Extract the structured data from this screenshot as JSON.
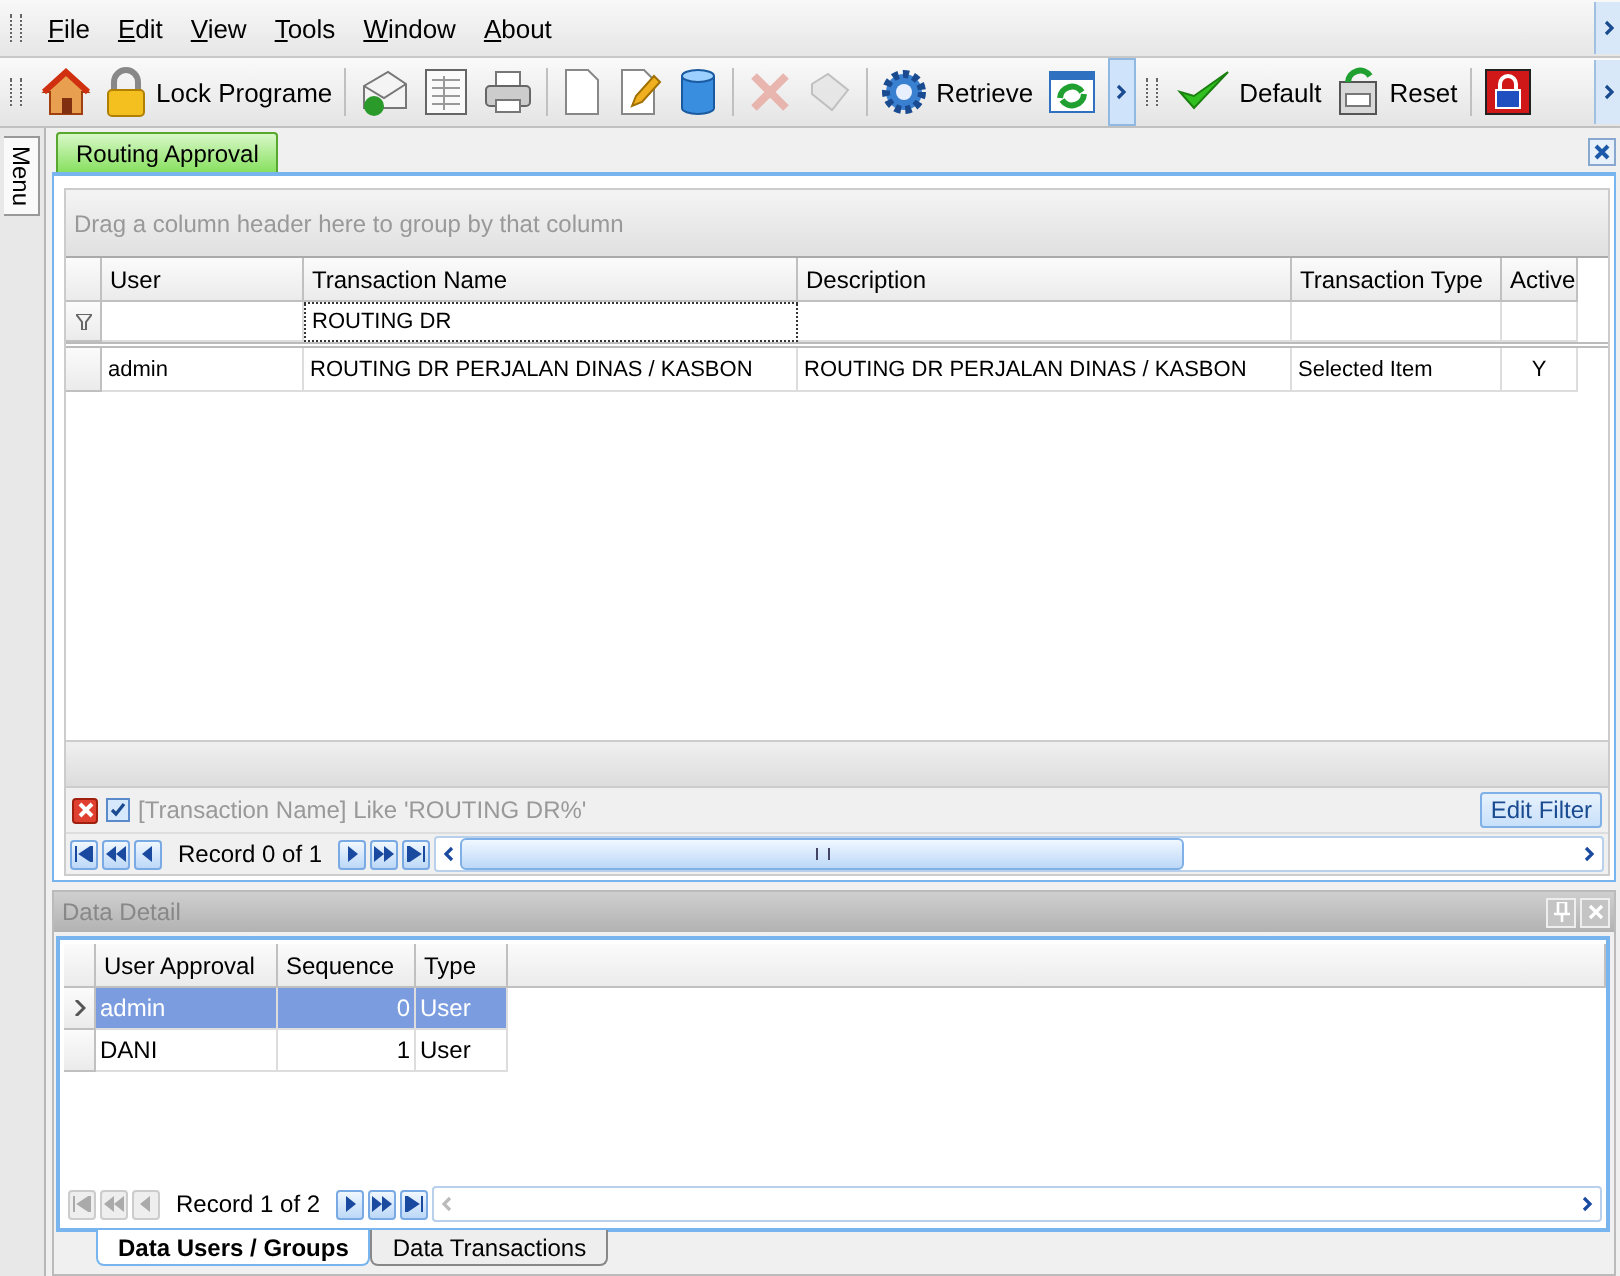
{
  "menu": [
    {
      "label": "File"
    },
    {
      "label": "Edit"
    },
    {
      "label": "View"
    },
    {
      "label": "Tools"
    },
    {
      "label": "Window"
    },
    {
      "label": "About"
    }
  ],
  "toolbar": {
    "lock_label": "Lock Programe",
    "retrieve_label": "Retrieve",
    "default_label": "Default",
    "reset_label": "Reset",
    "delete_disabled": true,
    "save_disabled": true
  },
  "side_tab": "Menu",
  "tabs": [
    {
      "label": "Routing Approval",
      "selected": true
    }
  ],
  "grid": {
    "group_hint": "Drag a column header here to group by that column",
    "columns": [
      "User",
      "Transaction Name",
      "Description",
      "Transaction Type",
      "Active"
    ],
    "filter_row": [
      {
        "focused": false
      },
      {
        "value": "ROUTING DR",
        "focused": true
      },
      {
        "focused": false
      },
      {
        "focused": false
      },
      {
        "focused": false
      }
    ],
    "rows": [
      {
        "cells": [
          "admin",
          "ROUTING DR PERJALAN DINAS / KASBON",
          "ROUTING DR PERJALAN DINAS / KASBON",
          "Selected Item",
          "Y"
        ],
        "selected": false
      }
    ],
    "filter": {
      "enabled": true,
      "text": "[Transaction Name] Like 'ROUTING DR%'",
      "edit_label": "Edit Filter"
    },
    "navigator": {
      "record": "Record 0 of 1",
      "first_disabled": false,
      "prev_disabled": false,
      "next_disabled": false
    }
  },
  "detail": {
    "title": "Data Detail",
    "columns": [
      "User Approval",
      "Sequence",
      "Type"
    ],
    "rows": [
      {
        "cells": [
          "admin",
          "0",
          "User"
        ],
        "selected": true
      },
      {
        "cells": [
          "DANI",
          "1",
          "User"
        ],
        "selected": false
      }
    ],
    "navigator": {
      "record": "Record 1 of 2",
      "first_disabled": true,
      "prev_disabled": true,
      "next_disabled": false
    },
    "tabs": [
      {
        "label": "Data Users / Groups",
        "selected": true
      },
      {
        "label": "Data Transactions",
        "selected": false
      }
    ]
  }
}
